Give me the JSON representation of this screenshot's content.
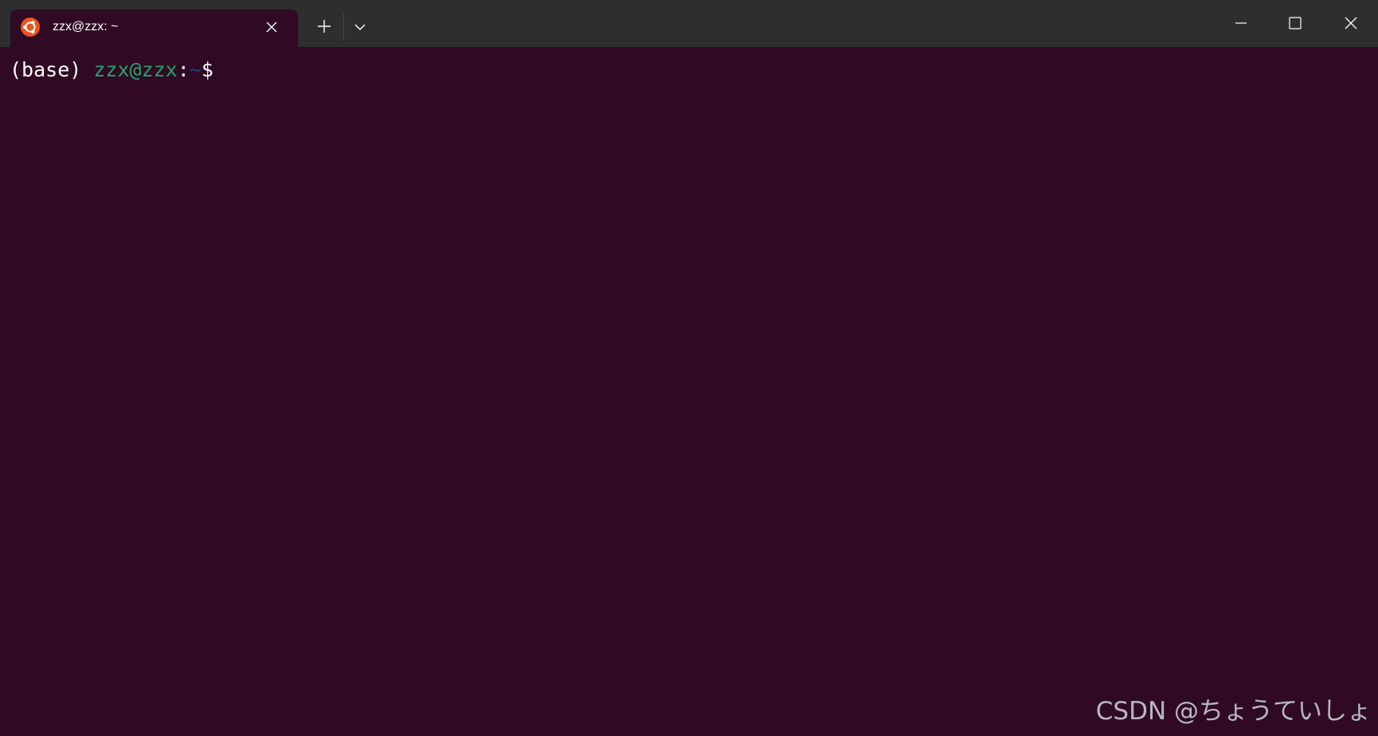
{
  "window": {
    "tab_title": "zzx@zzx: ~",
    "tab_icon": "ubuntu-logo-icon",
    "buttons": {
      "close_tab": "close-icon",
      "new_tab": "plus-icon",
      "dropdown": "chevron-down-icon",
      "minimize": "minimize-icon",
      "maximize": "maximize-icon",
      "close_window": "close-icon"
    }
  },
  "terminal": {
    "prompt": {
      "env": "(base)",
      "user_host": "zzx@zzx",
      "colon": ":",
      "path": "~",
      "symbol": "$"
    }
  },
  "watermark": "CSDN @ちょうていしょ",
  "colors": {
    "background": "#300a24",
    "titlebar": "#2e2e2e",
    "user_host": "#26a269",
    "path": "#12488b",
    "ubuntu_orange": "#e95420"
  }
}
